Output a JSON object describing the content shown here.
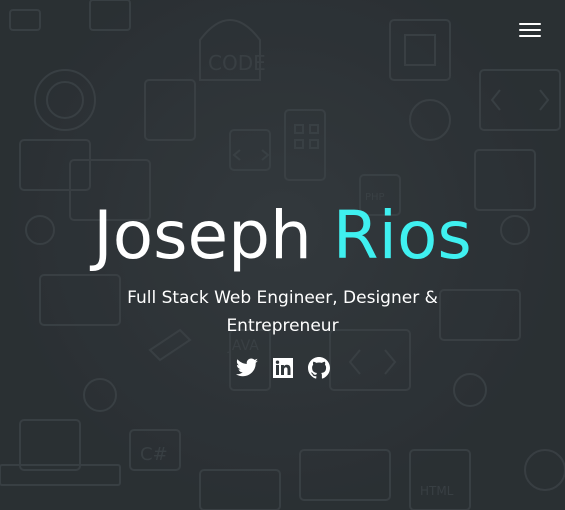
{
  "hero": {
    "first_name": "Joseph",
    "last_name": "Rios",
    "tagline": "Full Stack Web Engineer, Designer & Entrepreneur",
    "accent_color": "#3ff0f0",
    "text_color": "#ffffff",
    "background_color": "#30363a"
  },
  "header": {
    "menu_icon": "hamburger-menu-icon"
  },
  "socials": [
    {
      "icon": "twitter-icon"
    },
    {
      "icon": "linkedin-icon"
    },
    {
      "icon": "github-icon"
    }
  ]
}
